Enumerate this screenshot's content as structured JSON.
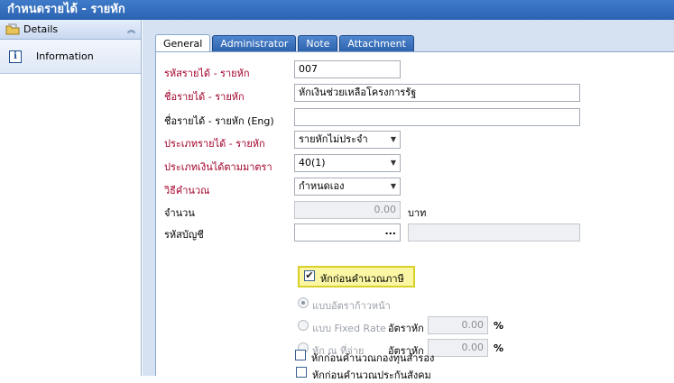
{
  "window": {
    "title": "กำหนดรายได้ - รายหัก"
  },
  "sidebar": {
    "header": {
      "label": "Details",
      "icon": "folder-icon",
      "collapse_icon": "double-chevron-up-icon"
    },
    "items": [
      {
        "label": "Information",
        "icon": "info-icon"
      }
    ]
  },
  "tabs": [
    {
      "label": "General",
      "active": true
    },
    {
      "label": "Administrator",
      "active": false
    },
    {
      "label": "Note",
      "active": false
    },
    {
      "label": "Attachment",
      "active": false
    }
  ],
  "form": {
    "code": {
      "label": "รหัสรายได้ - รายหัก",
      "value": "007"
    },
    "name": {
      "label": "ชื่อรายได้ - รายหัก",
      "value": "หักเงินช่วยเหลือโครงการรัฐ"
    },
    "name_en": {
      "label": "ชื่อรายได้ - รายหัก (Eng)",
      "value": ""
    },
    "type": {
      "label": "ประเภทรายได้ - รายหัก",
      "value": "รายหักไม่ประจำ"
    },
    "tax_type": {
      "label": "ประเภทเงินได้ตามมาตรา",
      "value": "40(1)"
    },
    "calc_method": {
      "label": "วิธีคำนวณ",
      "value": "กำหนดเอง"
    },
    "amount": {
      "label": "จำนวน",
      "value": "0.00",
      "unit": "บาท"
    },
    "account": {
      "label": "รหัสบัญชี",
      "value": "",
      "button": "...",
      "description": ""
    },
    "deduct_before_tax": {
      "label": "หักก่อนคำนวณภาษี",
      "checked": true
    },
    "rate_progressive": {
      "label": "แบบอัตราก้าวหน้า",
      "selected": true
    },
    "rate_fixed": {
      "label": "แบบ Fixed Rate",
      "rate_label": "อัตราหัก",
      "rate_value": "0.00",
      "unit": "%"
    },
    "withhold_at_payment": {
      "label": "หัก ณ ที่จ่าย",
      "rate_label": "อัตราหัก",
      "rate_value": "0.00",
      "unit": "%"
    },
    "deduct_before_social": {
      "label": "หักก่อนคำนวณประกันสังคม",
      "checked": false
    },
    "deduct_before_fund": {
      "label": "หักก่อนคำนวณกองทุนสำรอง",
      "checked": false
    }
  },
  "colors": {
    "title_bar": "#2f6ab8",
    "required_label": "#a2002a",
    "highlight": "#fbf6a3"
  }
}
